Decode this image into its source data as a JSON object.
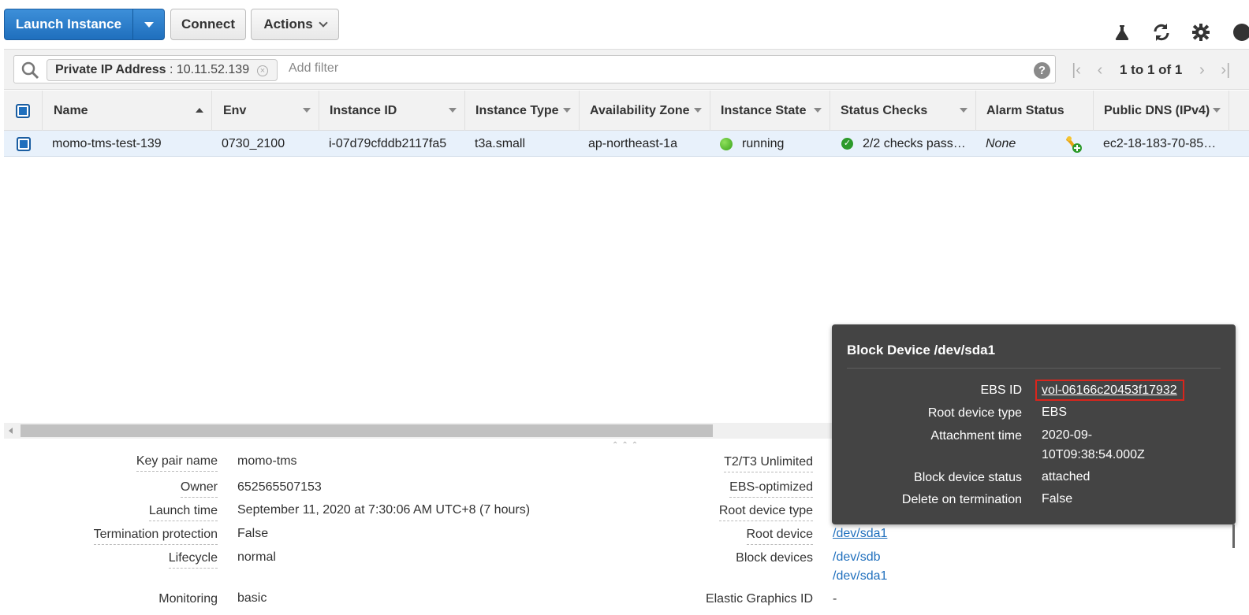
{
  "toolbar": {
    "launch_label": "Launch Instance",
    "connect_label": "Connect",
    "actions_label": "Actions"
  },
  "filter": {
    "token_key": "Private IP Address",
    "token_sep": " : ",
    "token_value": "10.11.52.139",
    "placeholder": "Add filter",
    "help": "?"
  },
  "pager": {
    "text": "1 to 1 of 1"
  },
  "table": {
    "columns": [
      "Name",
      "Env",
      "Instance ID",
      "Instance Type",
      "Availability Zone",
      "Instance State",
      "Status Checks",
      "Alarm Status",
      "Public DNS (IPv4)"
    ],
    "row": {
      "name": "momo-tms-test-139",
      "env": "0730_2100",
      "instance_id": "i-07d79cfddb2117fa5",
      "instance_type": "t3a.small",
      "az": "ap-northeast-1a",
      "state": "running",
      "checks": "2/2 checks pass…",
      "alarm": "None",
      "dns": "ec2-18-183-70-85…"
    }
  },
  "details": {
    "left": [
      {
        "label": "Key pair name",
        "value": "momo-tms"
      },
      {
        "label": "Owner",
        "value": "652565507153"
      },
      {
        "label": "Launch time",
        "value": "September 11, 2020 at 7:30:06 AM UTC+8 (7 hours)"
      },
      {
        "label": "Termination protection",
        "value": "False"
      },
      {
        "label": "Lifecycle",
        "value": "normal"
      },
      {
        "label": "Monitoring",
        "value": "basic"
      }
    ],
    "right": [
      {
        "label": "T2/T3 Unlimited"
      },
      {
        "label": "EBS-optimized"
      },
      {
        "label": "Root device type"
      },
      {
        "label": "Root device",
        "value": "/dev/sda1"
      },
      {
        "label": "Block devices",
        "values": [
          "/dev/sdb",
          "/dev/sda1"
        ]
      },
      {
        "label": "Elastic Graphics ID",
        "value": "-"
      }
    ]
  },
  "popover": {
    "title": "Block Device /dev/sda1",
    "ebs_id_label": "EBS ID",
    "ebs_id": "vol-06166c20453f17932",
    "root_type_label": "Root device type",
    "root_type": "EBS",
    "attach_label": "Attachment time",
    "attach_line1": "2020-09-",
    "attach_line2": "10T09:38:54.000Z",
    "status_label": "Block device status",
    "status": "attached",
    "dot_label": "Delete on termination",
    "dot": "False"
  },
  "colors": {
    "primary": "#1f6fbd",
    "popover_bg": "#444444",
    "highlight": "#d9251c",
    "row_selected": "#e8f1fb"
  }
}
